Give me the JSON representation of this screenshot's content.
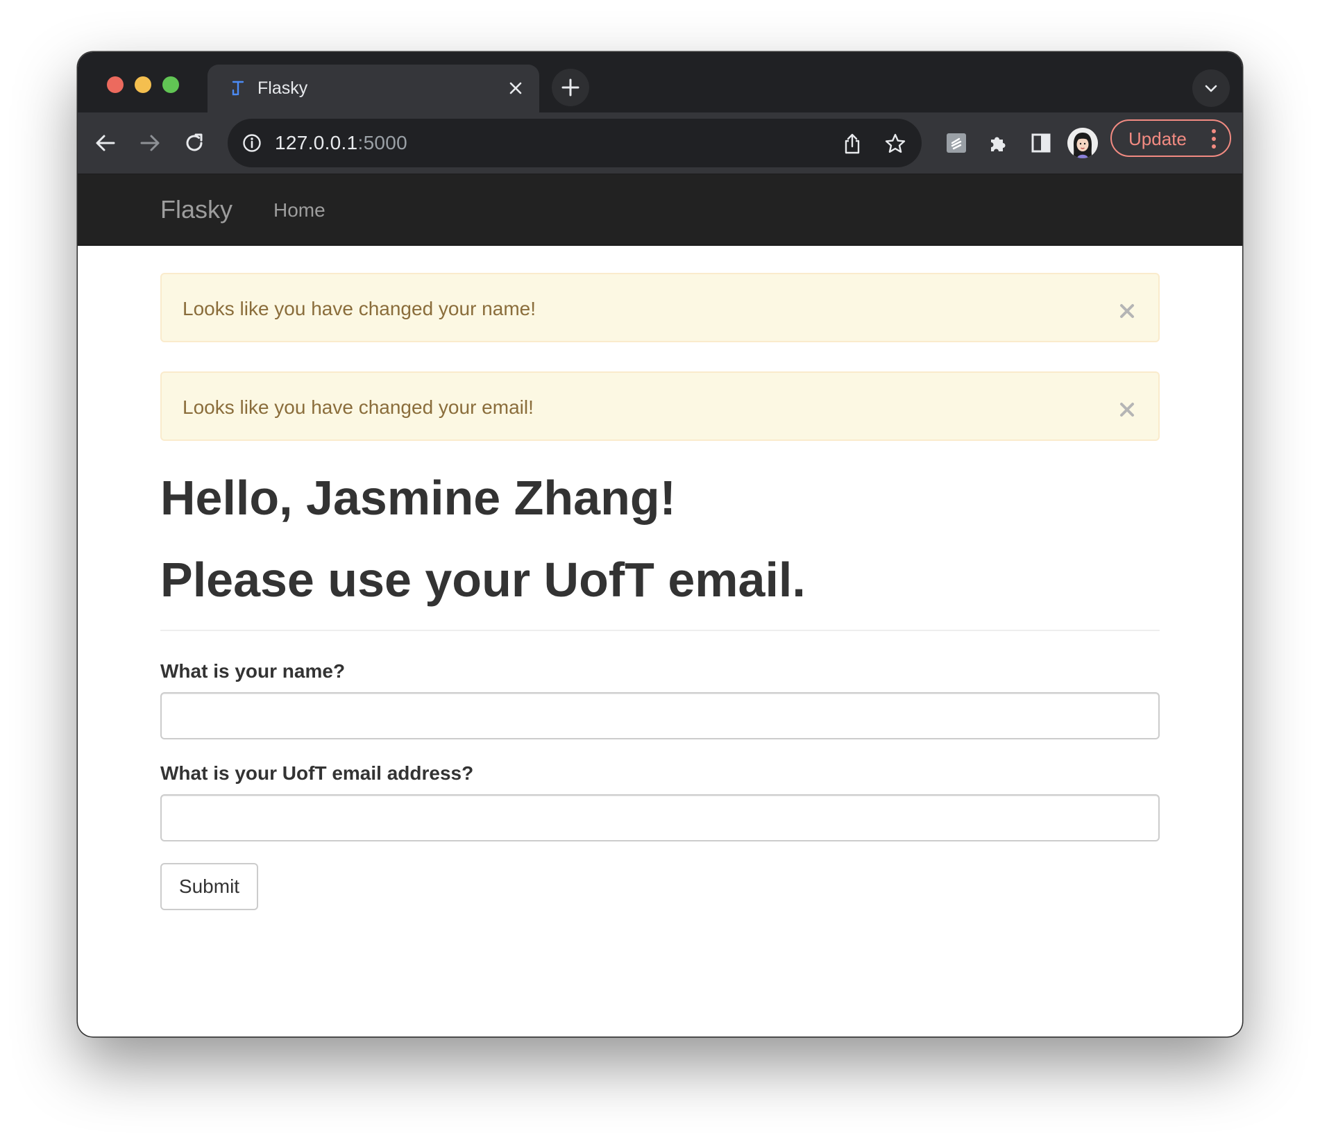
{
  "browser": {
    "tab": {
      "title": "Flasky",
      "favicon": "flask-favicon-icon"
    },
    "url": {
      "host": "127.0.0.1",
      "port": ":5000"
    },
    "update_label": "Update",
    "icons": [
      "back-arrow-icon",
      "forward-arrow-icon",
      "reload-icon",
      "site-info-icon",
      "share-icon",
      "bookmark-star-icon",
      "extension-icon",
      "puzzle-extensions-icon",
      "side-panel-icon",
      "profile-avatar",
      "more-menu-icon",
      "tab-search-chevron-icon",
      "new-tab-plus-icon",
      "close-tab-icon"
    ]
  },
  "navbar": {
    "brand": "Flasky",
    "links": [
      {
        "label": "Home"
      }
    ]
  },
  "alerts": [
    {
      "message": "Looks like you have changed your name!"
    },
    {
      "message": "Looks like you have changed your email!"
    }
  ],
  "page": {
    "greeting": "Hello, Jasmine Zhang!",
    "notice": "Please use your UofT email."
  },
  "form": {
    "name_label": "What is your name?",
    "name_value": "",
    "email_label": "What is your UofT email address?",
    "email_value": "",
    "submit_label": "Submit"
  },
  "colors": {
    "navbar_bg": "#222222",
    "alert_bg": "#fcf8e3",
    "alert_text": "#8a6d3b",
    "update_accent": "#f28b82"
  }
}
